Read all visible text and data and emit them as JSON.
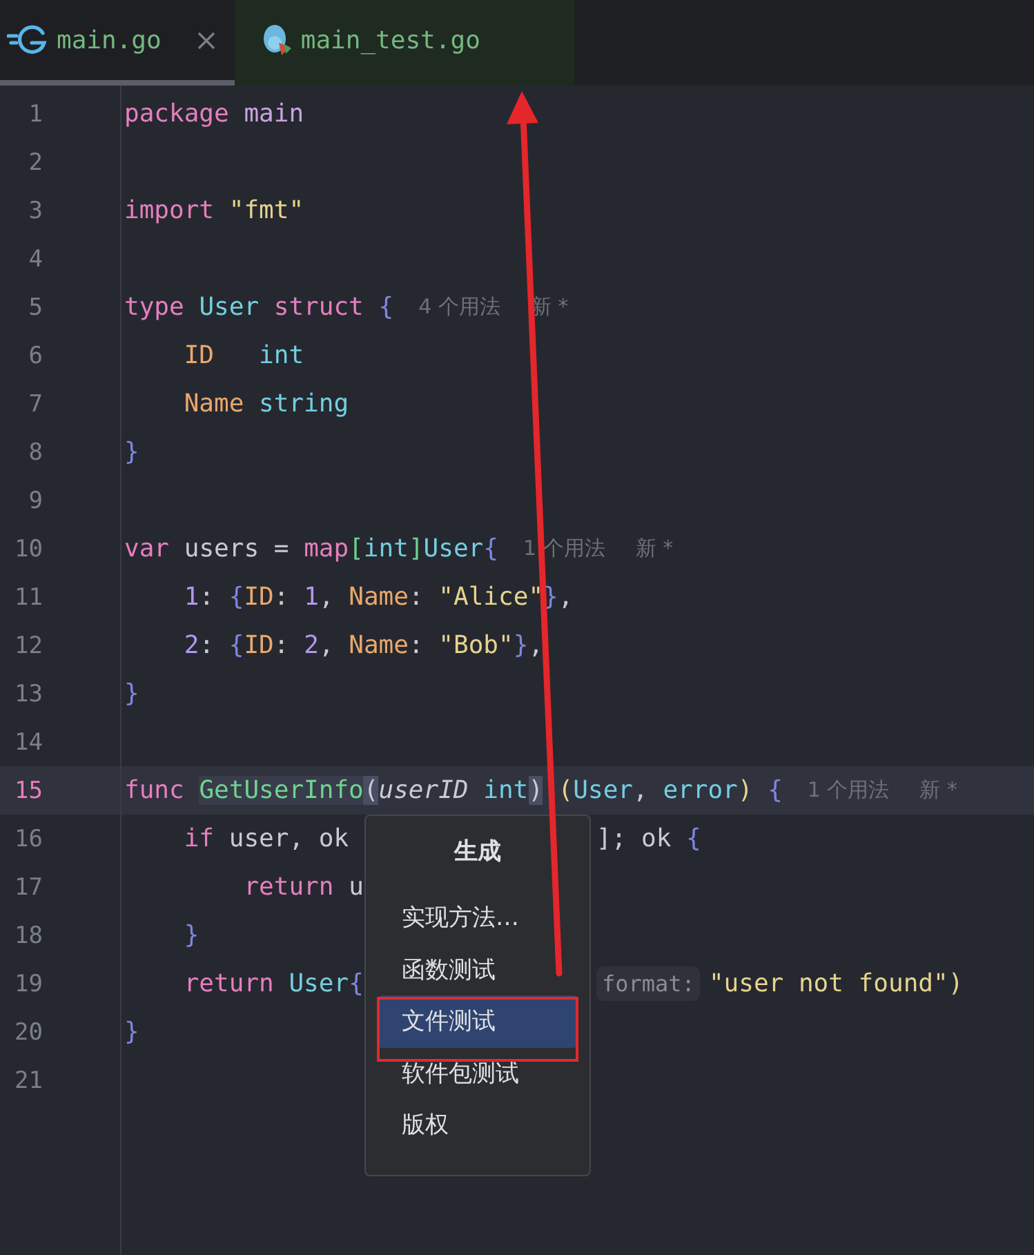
{
  "tabs": [
    {
      "label": "main.go",
      "selected": true,
      "closable": true
    },
    {
      "label": "main_test.go",
      "selected": false,
      "closable": false
    }
  ],
  "editor": {
    "lines": [
      {
        "number": "1",
        "current": false,
        "tokens": [
          {
            "kind": "kw",
            "text": "package "
          },
          {
            "kind": "pkg",
            "text": "main"
          }
        ]
      },
      {
        "number": "2",
        "current": false
      },
      {
        "number": "3",
        "current": false,
        "tokens": [
          {
            "kind": "kw",
            "text": "import "
          },
          {
            "kind": "str",
            "text": "\"fmt\""
          }
        ]
      },
      {
        "number": "4",
        "current": false
      },
      {
        "number": "5",
        "current": false,
        "tokens": [
          {
            "kind": "kw",
            "text": "type "
          },
          {
            "kind": "type",
            "text": "User "
          },
          {
            "kind": "kw",
            "text": "struct "
          },
          {
            "kind": "brace",
            "text": "{"
          },
          {
            "kind": "hint",
            "text": "4 个用法"
          },
          {
            "kind": "hint",
            "text": "新 *"
          }
        ]
      },
      {
        "number": "6",
        "current": false,
        "tokens": [
          {
            "kind": "field",
            "text": "    ID   "
          },
          {
            "kind": "type",
            "text": "int"
          }
        ]
      },
      {
        "number": "7",
        "current": false,
        "tokens": [
          {
            "kind": "field",
            "text": "    Name "
          },
          {
            "kind": "type",
            "text": "string"
          }
        ]
      },
      {
        "number": "8",
        "current": false,
        "tokens": [
          {
            "kind": "brace",
            "text": "}"
          }
        ]
      },
      {
        "number": "9",
        "current": false
      },
      {
        "number": "10",
        "current": false,
        "tokens": [
          {
            "kind": "kw",
            "text": "var "
          },
          {
            "kind": "plain",
            "text": "users = "
          },
          {
            "kind": "kw",
            "text": "map"
          },
          {
            "kind": "bracket",
            "text": "["
          },
          {
            "kind": "type",
            "text": "int"
          },
          {
            "kind": "bracket",
            "text": "]"
          },
          {
            "kind": "type",
            "text": "User"
          },
          {
            "kind": "brace",
            "text": "{"
          },
          {
            "kind": "hint",
            "text": "1 个用法"
          },
          {
            "kind": "hint",
            "text": "新 *"
          }
        ]
      },
      {
        "number": "11",
        "current": false,
        "tokens": [
          {
            "kind": "num",
            "text": "    1"
          },
          {
            "kind": "plain",
            "text": ": "
          },
          {
            "kind": "brace",
            "text": "{"
          },
          {
            "kind": "field",
            "text": "ID"
          },
          {
            "kind": "plain",
            "text": ": "
          },
          {
            "kind": "num",
            "text": "1"
          },
          {
            "kind": "plain",
            "text": ", "
          },
          {
            "kind": "field",
            "text": "Name"
          },
          {
            "kind": "plain",
            "text": ": "
          },
          {
            "kind": "str",
            "text": "\"Alice\""
          },
          {
            "kind": "brace",
            "text": "}"
          },
          {
            "kind": "plain",
            "text": ","
          }
        ]
      },
      {
        "number": "12",
        "current": false,
        "tokens": [
          {
            "kind": "num",
            "text": "    2"
          },
          {
            "kind": "plain",
            "text": ": "
          },
          {
            "kind": "brace",
            "text": "{"
          },
          {
            "kind": "field",
            "text": "ID"
          },
          {
            "kind": "plain",
            "text": ": "
          },
          {
            "kind": "num",
            "text": "2"
          },
          {
            "kind": "plain",
            "text": ", "
          },
          {
            "kind": "field",
            "text": "Name"
          },
          {
            "kind": "plain",
            "text": ": "
          },
          {
            "kind": "str",
            "text": "\"Bob\""
          },
          {
            "kind": "brace",
            "text": "}"
          },
          {
            "kind": "plain",
            "text": ","
          }
        ]
      },
      {
        "number": "13",
        "current": false,
        "tokens": [
          {
            "kind": "brace",
            "text": "}"
          }
        ]
      },
      {
        "number": "14",
        "current": false
      },
      {
        "number": "15",
        "current": true,
        "tokens": [
          {
            "kind": "kw",
            "text": "func "
          },
          {
            "kind": "fnsel",
            "text": "GetUserInfo"
          },
          {
            "kind": "paren",
            "text": "("
          },
          {
            "kind": "param",
            "text": "userID "
          },
          {
            "kind": "type",
            "text": "int"
          },
          {
            "kind": "paren",
            "text": ")"
          },
          {
            "kind": "yparen",
            "text": " ("
          },
          {
            "kind": "type",
            "text": "User"
          },
          {
            "kind": "plain",
            "text": ", "
          },
          {
            "kind": "type",
            "text": "error"
          },
          {
            "kind": "yparen",
            "text": ")"
          },
          {
            "kind": "brace",
            "text": " {"
          },
          {
            "kind": "hint",
            "text": "1 个用法"
          },
          {
            "kind": "hint",
            "text": "新 *"
          }
        ]
      },
      {
        "number": "16",
        "current": false,
        "tokens": [
          {
            "kind": "kw",
            "text": "    if "
          },
          {
            "kind": "plain",
            "text": "user, ok"
          }
        ],
        "tokens_after": [
          {
            "kind": "plain",
            "text": "]; ok "
          },
          {
            "kind": "brace",
            "text": "{"
          }
        ]
      },
      {
        "number": "17",
        "current": false,
        "tokens": [
          {
            "kind": "kw",
            "text": "        return "
          },
          {
            "kind": "plain",
            "text": "u"
          }
        ]
      },
      {
        "number": "18",
        "current": false,
        "tokens": [
          {
            "kind": "brace",
            "text": "    }"
          }
        ]
      },
      {
        "number": "19",
        "current": false,
        "tokens": [
          {
            "kind": "kw",
            "text": "    return "
          },
          {
            "kind": "type",
            "text": "User"
          },
          {
            "kind": "brace",
            "text": "{"
          }
        ],
        "tokens_after": [
          {
            "kind": "inlay",
            "text": "format:"
          },
          {
            "kind": "str",
            "text": "\"user not found\""
          },
          {
            "kind": "yparen",
            "text": ")"
          }
        ]
      },
      {
        "number": "20",
        "current": false,
        "tokens": [
          {
            "kind": "brace",
            "text": "}"
          }
        ]
      },
      {
        "number": "21",
        "current": false
      }
    ]
  },
  "context_menu": {
    "title": "生成",
    "items": [
      {
        "label": "实现方法…",
        "selected": false,
        "framed": false
      },
      {
        "label": "函数测试",
        "selected": false,
        "framed": false
      },
      {
        "label": "文件测试",
        "selected": true,
        "framed": true
      },
      {
        "label": "软件包测试",
        "selected": false,
        "framed": false
      },
      {
        "label": "版权",
        "selected": false,
        "framed": false
      }
    ]
  },
  "arrow_annotation": true
}
